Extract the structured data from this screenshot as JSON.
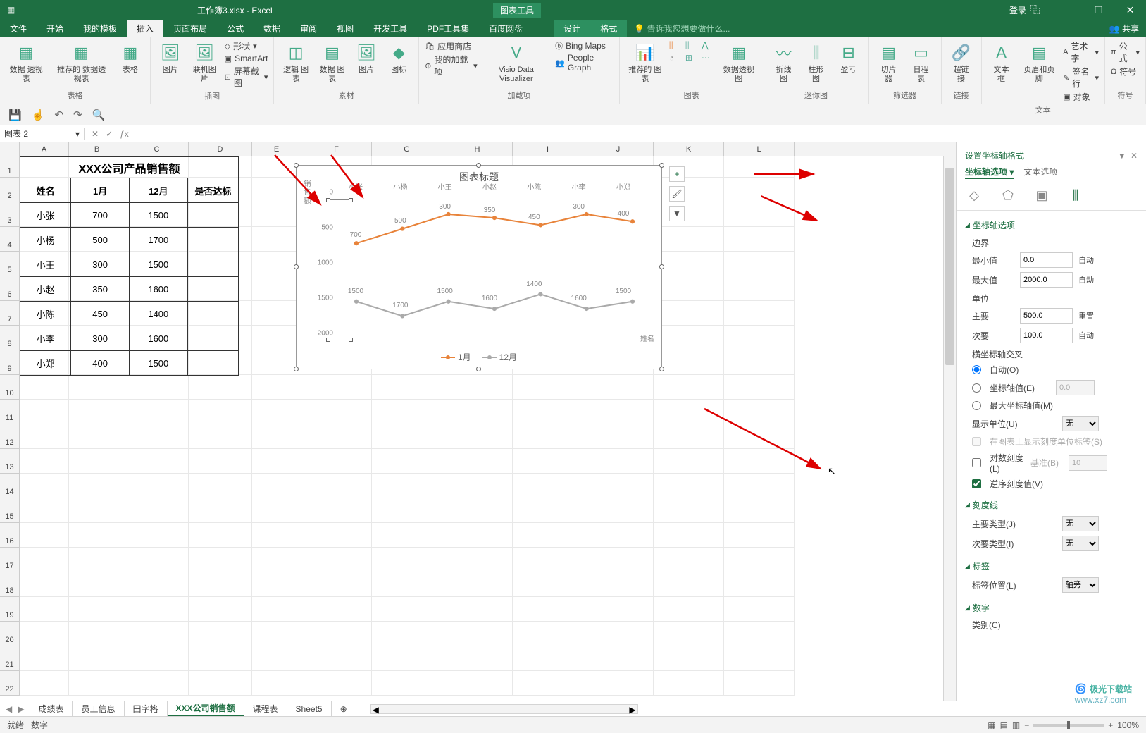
{
  "title": {
    "filename": "工作簿3.xlsx - Excel",
    "tools": "图表工具",
    "login": "登录"
  },
  "winbtns": {
    "restore": "⿻",
    "min": "—",
    "max": "☐",
    "close": "✕"
  },
  "tabs": [
    "文件",
    "开始",
    "我的模板",
    "插入",
    "页面布局",
    "公式",
    "数据",
    "审阅",
    "视图",
    "开发工具",
    "PDF工具集",
    "百度网盘"
  ],
  "ctx_tabs": [
    "设计",
    "格式"
  ],
  "active_tab": "插入",
  "tell_me": "告诉我您想要做什么...",
  "share": "共享",
  "ribbon": {
    "tables": {
      "pivot": "数据\n透视表",
      "rec_pivot": "推荐的\n数据透视表",
      "table": "表格",
      "label": "表格"
    },
    "illust": {
      "pic": "图片",
      "online": "联机图片",
      "shapes": "形状",
      "smartart": "SmartArt",
      "screenshot": "屏幕截图",
      "label": "插图"
    },
    "addins": {
      "store": "应用商店",
      "myaddins": "我的加载项",
      "visio": "Visio Data\nVisualizer",
      "bing": "Bing Maps",
      "people": "People Graph",
      "label": "加载项"
    },
    "models": {
      "logic": "逻辑\n图表",
      "data_c": "数据\n图表",
      "pic_c": "图片",
      "icon_c": "图标",
      "label": "素材"
    },
    "charts": {
      "rec": "推荐的\n图表",
      "pivot": "数据透视图",
      "label": "图表"
    },
    "spark": {
      "line": "折线图",
      "col": "柱形图",
      "winloss": "盈亏",
      "label": "迷你图"
    },
    "filter": {
      "slicer": "切片器",
      "timeline": "日程表",
      "label": "筛选器"
    },
    "links": {
      "link": "超链接",
      "label": "链接"
    },
    "text": {
      "textbox": "文本框",
      "hf": "页眉和页脚",
      "wordart": "艺术字",
      "sig": "签名行",
      "obj": "对象",
      "label": "文本"
    },
    "symbols": {
      "eq": "公式",
      "sym": "符号",
      "label": "符号"
    }
  },
  "namebox": "图表 2",
  "colwidths": {
    "A": 70,
    "B": 80,
    "C": 90,
    "D": 90,
    "E": 70,
    "F": 100,
    "G": 100,
    "H": 100,
    "I": 100,
    "J": 100,
    "K": 100,
    "L": 100
  },
  "table": {
    "title": "XXX公司产品销售额",
    "headers": [
      "姓名",
      "1月",
      "12月",
      "是否达标"
    ],
    "rows": [
      [
        "小张",
        "700",
        "1500",
        ""
      ],
      [
        "小杨",
        "500",
        "1700",
        ""
      ],
      [
        "小王",
        "300",
        "1500",
        ""
      ],
      [
        "小赵",
        "350",
        "1600",
        ""
      ],
      [
        "小陈",
        "450",
        "1400",
        ""
      ],
      [
        "小李",
        "300",
        "1600",
        ""
      ],
      [
        "小郑",
        "400",
        "1500",
        ""
      ]
    ]
  },
  "chart_data": {
    "type": "line",
    "title": "图表标题",
    "ylabel": "销售额",
    "xlabel": "姓名",
    "categories": [
      "小张",
      "小杨",
      "小王",
      "小赵",
      "小陈",
      "小李",
      "小郑"
    ],
    "series": [
      {
        "name": "1月",
        "color": "#e8833a",
        "values": [
          700,
          500,
          300,
          350,
          450,
          300,
          400
        ]
      },
      {
        "name": "12月",
        "color": "#aaaaaa",
        "values": [
          1500,
          1700,
          1500,
          1600,
          1400,
          1600,
          1500
        ]
      }
    ],
    "yticks": [
      0,
      500,
      1000,
      1500,
      2000
    ],
    "ylim": [
      0,
      2000
    ],
    "y_reversed": true
  },
  "fmt": {
    "title": "设置坐标轴格式",
    "close": "✕",
    "dd": "▼",
    "tab1": "坐标轴选项",
    "tab2": "文本选项",
    "sect_axis": "坐标轴选项",
    "bounds": "边界",
    "min": "最小值",
    "min_v": "0.0",
    "auto": "自动",
    "max": "最大值",
    "max_v": "2000.0",
    "units": "单位",
    "major": "主要",
    "major_v": "500.0",
    "reset": "重置",
    "minor": "次要",
    "minor_v": "100.0",
    "cross": "横坐标轴交叉",
    "cross_auto": "自动(O)",
    "cross_val": "坐标轴值(E)",
    "cross_val_v": "0.0",
    "cross_max": "最大坐标轴值(M)",
    "disp_unit": "显示单位(U)",
    "disp_unit_v": "无",
    "disp_chk": "在图表上显示刻度单位标签(S)",
    "log": "对数刻度(L)",
    "log_base": "基准(B)",
    "log_v": "10",
    "reverse": "逆序刻度值(V)",
    "sect_tick": "刻度线",
    "tick_major": "主要类型(J)",
    "tick_major_v": "无",
    "tick_minor": "次要类型(I)",
    "tick_minor_v": "无",
    "sect_label": "标签",
    "label_pos": "标签位置(L)",
    "label_pos_v": "轴旁",
    "sect_num": "数字",
    "num_cat": "类别(C)"
  },
  "sheets": [
    "成绩表",
    "员工信息",
    "田字格",
    "XXX公司销售额",
    "课程表",
    "Sheet5"
  ],
  "active_sheet": "XXX公司销售额",
  "status": {
    "ready": "就绪",
    "num": "数字",
    "zoom": "100%"
  },
  "watermark": {
    "name": "极光下载站",
    "url": "www.xz7.com"
  }
}
